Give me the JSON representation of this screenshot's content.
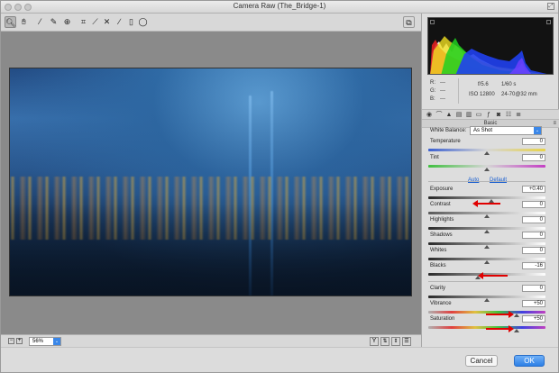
{
  "window": {
    "title": "Camera Raw (The_Bridge-1)"
  },
  "toolbar": {
    "tools": [
      "zoom-tool-icon",
      "hand-tool-icon",
      "white-balance-tool-icon",
      "color-sampler-tool-icon",
      "targeted-adjustment-tool-icon",
      "crop-tool-icon",
      "straighten-tool-icon",
      "spot-removal-tool-icon",
      "red-eye-tool-icon",
      "adjustment-brush-icon",
      "graduated-filter-icon",
      "radial-filter-icon"
    ]
  },
  "readout": {
    "r_label": "R:",
    "r_value": "---",
    "g_label": "G:",
    "g_value": "---",
    "b_label": "B:",
    "b_value": "---",
    "aperture": "f/5.6",
    "shutter": "1/60 s",
    "iso": "ISO 12800",
    "lens": "24-70@32 mm"
  },
  "panel": {
    "section_title": "Basic",
    "white_balance_label": "White Balance:",
    "white_balance_value": "As Shot",
    "auto_label": "Auto",
    "default_label": "Default",
    "sliders": [
      {
        "label": "Temperature",
        "value": "0",
        "level": 0.5
      },
      {
        "label": "Tint",
        "value": "0",
        "level": 0.5
      },
      {
        "label": "Exposure",
        "value": "+0.40",
        "level": 0.54
      },
      {
        "label": "Contrast",
        "value": "0",
        "level": 0.5
      },
      {
        "label": "Highlights",
        "value": "0",
        "level": 0.5
      },
      {
        "label": "Shadows",
        "value": "0",
        "level": 0.5
      },
      {
        "label": "Whites",
        "value": "0",
        "level": 0.5
      },
      {
        "label": "Blacks",
        "value": "-16",
        "level": 0.42
      },
      {
        "label": "Clarity",
        "value": "0",
        "level": 0.5
      },
      {
        "label": "Vibrance",
        "value": "+50",
        "level": 0.75
      },
      {
        "label": "Saturation",
        "value": "+50",
        "level": 0.75
      }
    ]
  },
  "bottombar": {
    "zoom": "56%"
  },
  "footer": {
    "cancel_label": "Cancel",
    "ok_label": "OK"
  },
  "colors": {
    "accent": "#3b87e8",
    "annotation": "#e00000"
  }
}
